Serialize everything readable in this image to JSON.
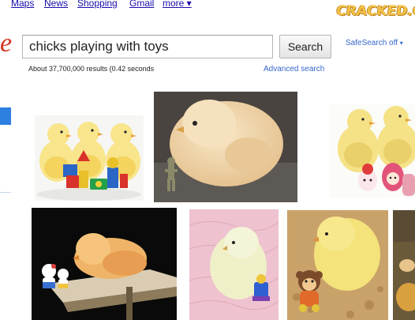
{
  "topnav": {
    "maps": "Maps",
    "news": "News",
    "shopping": "Shopping",
    "gmail": "Gmail",
    "more": "more ▾"
  },
  "watermark": {
    "text": "CRACKED.COM"
  },
  "search": {
    "query": "chicks playing with toys",
    "button_label": "Search",
    "safesearch": "SafeSearch off",
    "safesearch_caret": "▾"
  },
  "results": {
    "stats": "About 37,700,000 results (0.42 seconds",
    "advanced": "Advanced search"
  },
  "colors": {
    "link": "#1a0dab",
    "secondary_link": "#3366cc",
    "selected_tab": "#2d7fe0"
  }
}
